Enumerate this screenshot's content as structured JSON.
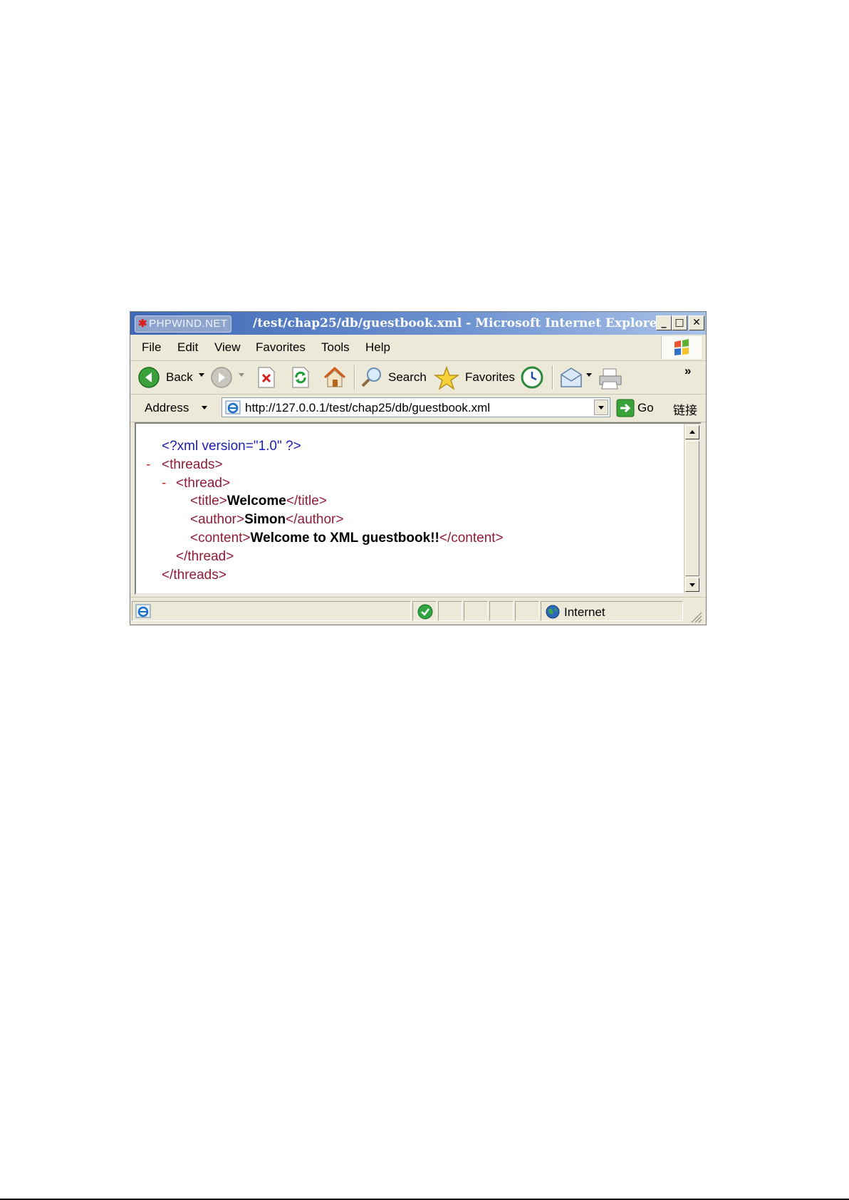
{
  "window": {
    "title_watermark": "PHPWIND.NET",
    "title": "/test/chap25/db/guestbook.xml - Microsoft Internet Explorer",
    "controls": {
      "minimize": "_",
      "maximize": "□",
      "close": "✕"
    }
  },
  "menu": {
    "items": [
      "File",
      "Edit",
      "View",
      "Favorites",
      "Tools",
      "Help"
    ]
  },
  "toolbar": {
    "back_label": "Back",
    "search_label": "Search",
    "favorites_label": "Favorites",
    "overflow": "»"
  },
  "address": {
    "label": "Address",
    "url": "http://127.0.0.1/test/chap25/db/guestbook.xml",
    "go_label": "Go",
    "links_label": "链接"
  },
  "xml": {
    "declaration": "<?xml version=\"1.0\" ?>",
    "collapse_marker": "-",
    "threads_open": "<threads>",
    "thread_open": "<thread>",
    "title_open": "<title>",
    "title_value": "Welcome",
    "title_close": "</title>",
    "author_open": "<author>",
    "author_value": "Simon",
    "author_close": "</author>",
    "content_open": "<content>",
    "content_value": "Welcome to XML guestbook!!",
    "content_close": "</content>",
    "thread_close": "</thread>",
    "threads_close": "</threads>"
  },
  "status": {
    "zone_label": "Internet"
  },
  "colors": {
    "title_bar": "#3f68b6",
    "xml_tag": "#8e1c35",
    "xml_declaration": "#1c1cb3",
    "collapse_marker": "#d42a2a"
  }
}
